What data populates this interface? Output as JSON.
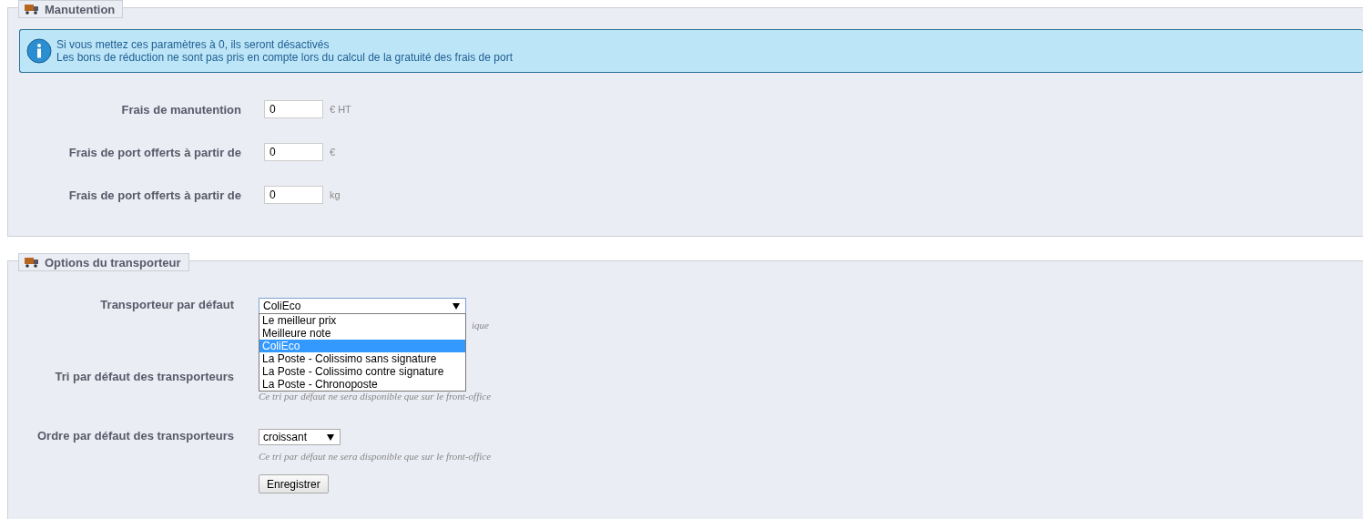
{
  "handling": {
    "legend": "Manutention",
    "info": [
      "Si vous mettez ces paramètres à 0, ils seront désactivés",
      "Les bons de réduction ne sont pas pris en compte lors du calcul de la gratuité des frais de port"
    ],
    "fields": [
      {
        "label": "Frais de manutention",
        "value": "0",
        "unit": "€ HT"
      },
      {
        "label": "Frais de port offerts à partir de",
        "value": "0",
        "unit": "€"
      },
      {
        "label": "Frais de port offerts à partir de",
        "value": "0",
        "unit": "kg"
      }
    ]
  },
  "carrier_options": {
    "legend": "Options du transporteur",
    "default_carrier": {
      "label": "Transporteur par défaut",
      "value": "ColiEco",
      "hint": "ique",
      "expanded": true,
      "options": [
        {
          "label": "Le meilleur prix",
          "selected": false
        },
        {
          "label": "Meilleure note",
          "selected": false
        },
        {
          "label": "ColiEco",
          "selected": true
        },
        {
          "label": "La Poste - Colissimo sans signature",
          "selected": false
        },
        {
          "label": "La Poste - Colissimo contre signature",
          "selected": false
        },
        {
          "label": "La Poste - Chronoposte",
          "selected": false
        }
      ]
    },
    "sort": {
      "label": "Tri par défaut des transporteurs",
      "hint": "Ce tri par défaut ne sera disponible que sur le front-office"
    },
    "order": {
      "label": "Ordre par défaut des transporteurs",
      "value": "croissant",
      "hint": "Ce tri par défaut ne sera disponible que sur le front-office"
    },
    "save_button": "Enregistrer"
  }
}
